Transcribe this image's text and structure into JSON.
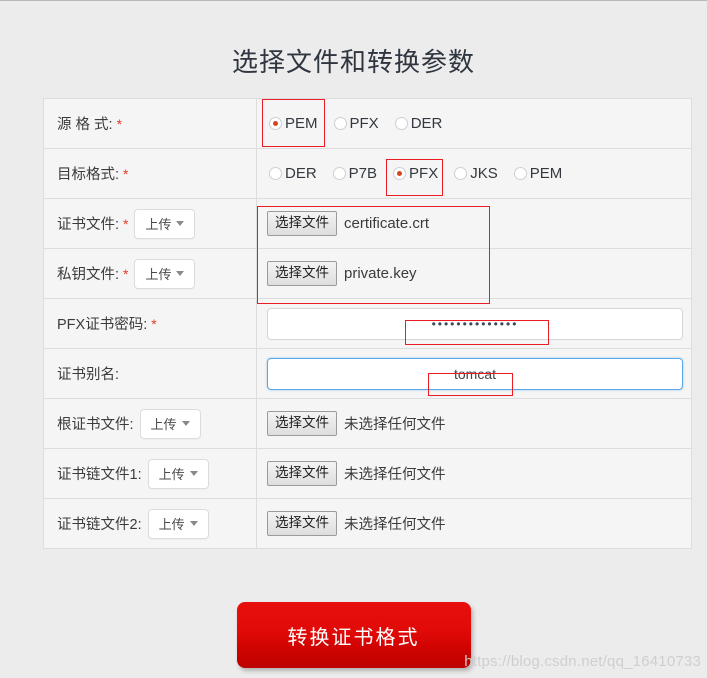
{
  "page": {
    "title": "选择文件和转换参数",
    "watermark": "https://blog.csdn.net/qq_16410733",
    "background_color": "#ececec",
    "accent_color": "#d9441f",
    "annotation_color": "#ec1c24"
  },
  "form": {
    "rows": [
      {
        "label": "源 格 式:",
        "required": true,
        "type": "radio-group",
        "options": [
          {
            "label": "PEM",
            "checked": true
          },
          {
            "label": "PFX",
            "checked": false
          },
          {
            "label": "DER",
            "checked": false
          }
        ]
      },
      {
        "label": "目标格式:",
        "required": true,
        "type": "radio-group",
        "options": [
          {
            "label": "DER",
            "checked": false
          },
          {
            "label": "P7B",
            "checked": false
          },
          {
            "label": "PFX",
            "checked": true
          },
          {
            "label": "JKS",
            "checked": false
          },
          {
            "label": "PEM",
            "checked": false
          }
        ]
      },
      {
        "label": "证书文件:",
        "required": true,
        "type": "file",
        "upload_label": "上传",
        "choose_label": "选择文件",
        "file_name": "certificate.crt"
      },
      {
        "label": "私钥文件:",
        "required": true,
        "type": "file",
        "upload_label": "上传",
        "choose_label": "选择文件",
        "file_name": "private.key"
      },
      {
        "label": "PFX证书密码:",
        "required": true,
        "type": "password",
        "value": "••••••••••••••",
        "placeholder": ""
      },
      {
        "label": "证书别名:",
        "required": false,
        "type": "text",
        "value": "tomcat",
        "placeholder": "",
        "focused": true
      },
      {
        "label": "根证书文件:",
        "required": false,
        "type": "file",
        "upload_label": "上传",
        "choose_label": "选择文件",
        "file_name": "未选择任何文件"
      },
      {
        "label": "证书链文件1:",
        "required": false,
        "type": "file",
        "upload_label": "上传",
        "choose_label": "选择文件",
        "file_name": "未选择任何文件"
      },
      {
        "label": "证书链文件2:",
        "required": false,
        "type": "file",
        "upload_label": "上传",
        "choose_label": "选择文件",
        "file_name": "未选择任何文件"
      }
    ]
  },
  "submit": {
    "label": "转换证书格式"
  }
}
